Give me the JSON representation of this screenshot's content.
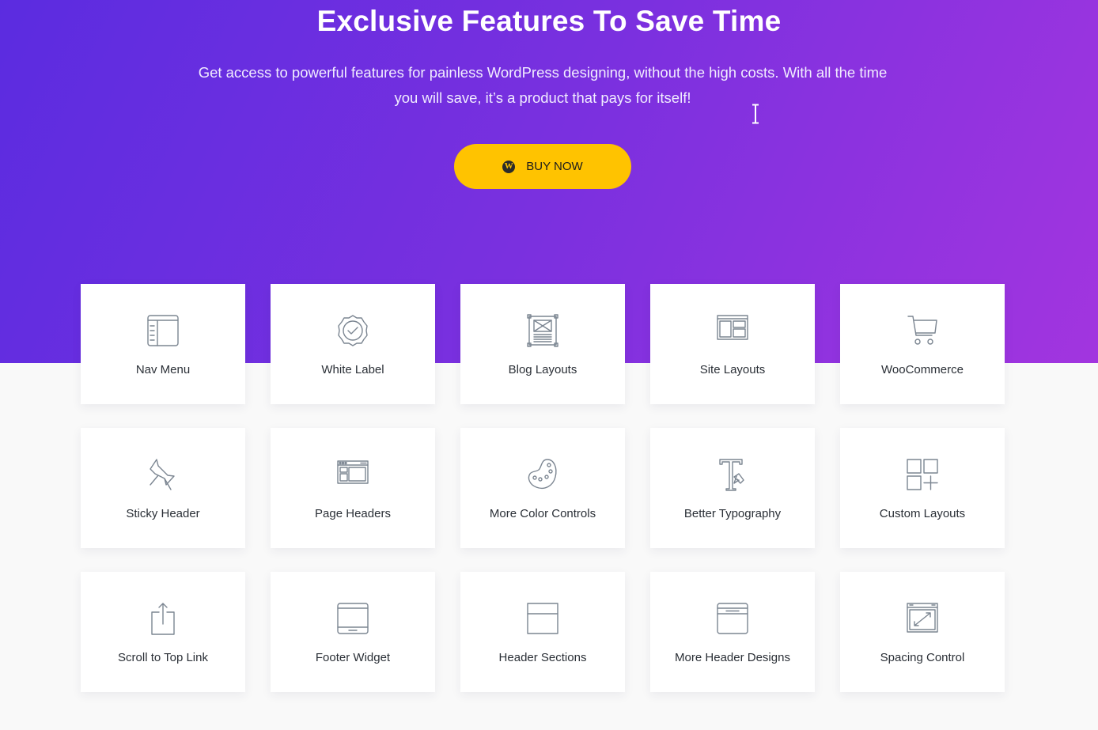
{
  "hero": {
    "title": "Exclusive Features To Save Time",
    "description": "Get access to powerful features for painless WordPress designing, without the high costs. With all the time you will save, it’s a product that pays for itself!",
    "buy_button": {
      "label": "BUY NOW",
      "icon": "wordpress-icon",
      "icon_glyph": "W"
    },
    "colors": {
      "gradient_start": "#5b2ce0",
      "gradient_end": "#a235df",
      "button": "#ffc300"
    }
  },
  "features": [
    {
      "label": "Nav Menu",
      "icon": "nav-menu-icon"
    },
    {
      "label": "White Label",
      "icon": "badge-check-icon"
    },
    {
      "label": "Blog Layouts",
      "icon": "blog-layout-icon"
    },
    {
      "label": "Site Layouts",
      "icon": "site-layout-icon"
    },
    {
      "label": "WooCommerce",
      "icon": "cart-icon"
    },
    {
      "label": "Sticky Header",
      "icon": "pushpin-icon"
    },
    {
      "label": "Page Headers",
      "icon": "page-header-icon"
    },
    {
      "label": "More Color Controls",
      "icon": "palette-icon"
    },
    {
      "label": "Better Typography",
      "icon": "typography-icon"
    },
    {
      "label": "Custom Layouts",
      "icon": "grid-plus-icon"
    },
    {
      "label": "Scroll to Top Link",
      "icon": "share-up-icon"
    },
    {
      "label": "Footer Widget",
      "icon": "footer-widget-icon"
    },
    {
      "label": "Header Sections",
      "icon": "header-section-icon"
    },
    {
      "label": "More Header Designs",
      "icon": "header-design-icon"
    },
    {
      "label": "Spacing Control",
      "icon": "resize-icon"
    }
  ]
}
